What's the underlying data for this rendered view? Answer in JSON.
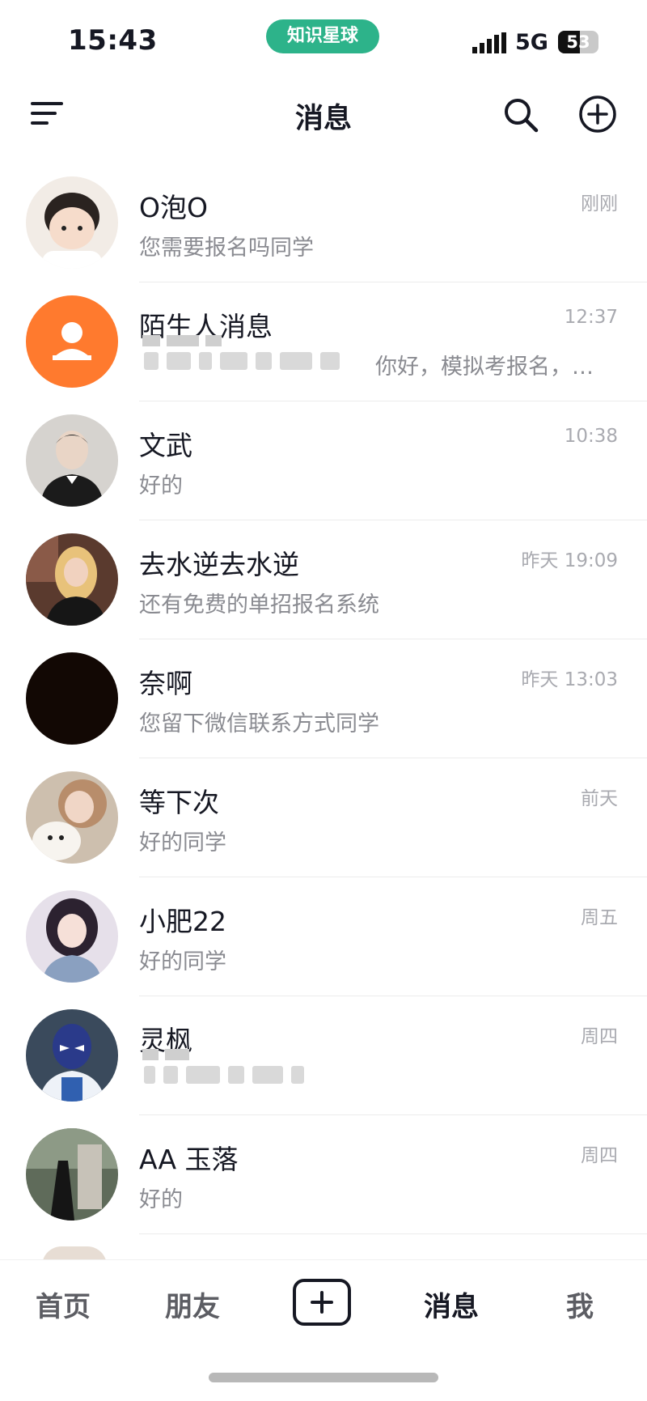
{
  "status_bar": {
    "time": "15:43",
    "app_pill": "知识星球",
    "network": "5G",
    "battery": "53",
    "battery_level": 0.53,
    "colors": {
      "pill": "#2db38a"
    }
  },
  "header": {
    "title": "消息",
    "icons": [
      "menu-icon",
      "search-icon",
      "add-circle-icon"
    ]
  },
  "conversations": [
    {
      "name": "O泡O",
      "message": "您需要报名吗同学",
      "time": "刚刚"
    },
    {
      "name": "陌生人消息",
      "message": "你好，模拟考报名，…",
      "time": "12:37"
    },
    {
      "name": "文武",
      "message": "好的",
      "time": "10:38"
    },
    {
      "name": "去水逆去水逆",
      "message": "还有免费的单招报名系统",
      "time": "昨天 19:09"
    },
    {
      "name": "奈啊",
      "message": "您留下微信联系方式同学",
      "time": "昨天 13:03"
    },
    {
      "name": "等下次",
      "message": "好的同学",
      "time": "前天"
    },
    {
      "name": "小肥22",
      "message": "好的同学",
      "time": "周五"
    },
    {
      "name": "灵枫",
      "message": "",
      "time": "周四"
    },
    {
      "name": "AA 玉落",
      "message": "好的",
      "time": "周四"
    }
  ],
  "bottom_nav": {
    "items": [
      {
        "label": "首页"
      },
      {
        "label": "朋友"
      },
      {
        "label": "消息"
      },
      {
        "label": "我"
      }
    ],
    "active": "消息",
    "center_icon": "plus-icon"
  }
}
